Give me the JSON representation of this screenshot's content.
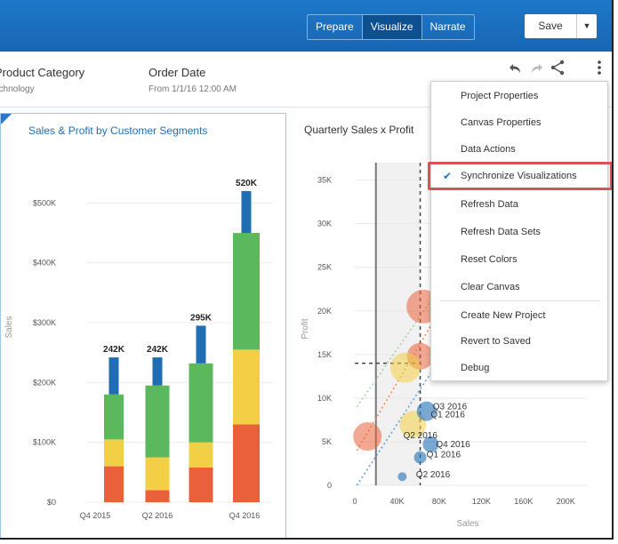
{
  "toolbar": {
    "tabs": [
      "Prepare",
      "Visualize",
      "Narrate"
    ],
    "active_tab": "Visualize",
    "save_label": "Save",
    "save_dropdown": "▼"
  },
  "filters": [
    {
      "title": "Product Category",
      "value": "Technology"
    },
    {
      "title": "Order Date",
      "value": "From 1/1/16 12:00 AM"
    }
  ],
  "icons": [
    "undo-icon",
    "redo-icon",
    "share-icon",
    "more-vertical-icon"
  ],
  "left_chart_title": "Sales & Profit by Customer Segments",
  "right_chart_title": "Quarterly Sales x Profit",
  "menu": {
    "items": [
      "Project Properties",
      "Canvas Properties",
      "Data Actions",
      "Synchronize Visualizations",
      "Refresh Data",
      "Refresh Data Sets",
      "Reset Colors",
      "Clear Canvas",
      "Create New Project",
      "Revert to Saved",
      "Debug"
    ],
    "checked_item": "Synchronize Visualizations",
    "check_icon": "✔"
  },
  "colors": {
    "accent": "#1f77c8",
    "seg_blue": "#1f6eb4",
    "seg_green": "#5cb85c",
    "seg_yellow": "#f2cf45",
    "seg_orange": "#e9603a",
    "highlight": "#d9534f"
  },
  "chart_data": [
    {
      "type": "bar",
      "title": "Sales & Profit by Customer Segments",
      "ylabel": "Sales",
      "yticks": [
        "$0",
        "$100K",
        "$200K",
        "$300K",
        "$400K",
        "$500K"
      ],
      "ylim": [
        0,
        560000
      ],
      "xticks": [
        "Q4 2015",
        "Q2 2016",
        "Q4 2016"
      ],
      "totals_labels": [
        "242K",
        "242K",
        "295K",
        "520K"
      ],
      "bars": [
        {
          "segments": [
            {
              "color": "orange",
              "from": 0,
              "to": 60000
            },
            {
              "color": "yellow",
              "from": 60000,
              "to": 105000
            },
            {
              "color": "green",
              "from": 105000,
              "to": 180000
            },
            {
              "color": "blue",
              "from": 180000,
              "to": 242000
            }
          ]
        },
        {
          "segments": [
            {
              "color": "orange",
              "from": 0,
              "to": 20000
            },
            {
              "color": "yellow",
              "from": 20000,
              "to": 75000
            },
            {
              "color": "green",
              "from": 75000,
              "to": 195000
            },
            {
              "color": "blue",
              "from": 195000,
              "to": 242000
            }
          ]
        },
        {
          "segments": [
            {
              "color": "orange",
              "from": 0,
              "to": 58000
            },
            {
              "color": "yellow",
              "from": 58000,
              "to": 100000
            },
            {
              "color": "green",
              "from": 100000,
              "to": 232000
            },
            {
              "color": "blue",
              "from": 232000,
              "to": 295000
            }
          ]
        },
        {
          "segments": [
            {
              "color": "orange",
              "from": 0,
              "to": 130000
            },
            {
              "color": "yellow",
              "from": 130000,
              "to": 255000
            },
            {
              "color": "green",
              "from": 255000,
              "to": 450000
            },
            {
              "color": "blue",
              "from": 450000,
              "to": 520000
            }
          ]
        }
      ]
    },
    {
      "type": "scatter",
      "title": "Quarterly Sales x Profit",
      "xlabel": "Sales",
      "ylabel": "Profit",
      "xticks": [
        "0",
        "40K",
        "80K",
        "120K",
        "160K",
        "200K"
      ],
      "yticks": [
        "0",
        "5K",
        "10K",
        "15K",
        "20K",
        "25K",
        "30K",
        "35K"
      ],
      "xlim": [
        0,
        220000
      ],
      "ylim": [
        0,
        37000
      ],
      "point_labels": [
        "Q3 2016",
        "Q1 2016",
        "Q2 2016",
        "Q4 2016",
        "Q1 2016",
        "Q2 2016"
      ],
      "points": [
        {
          "x": 65000,
          "y": 20500,
          "size": 19,
          "color": "orange"
        },
        {
          "x": 62000,
          "y": 14800,
          "size": 15,
          "color": "orange"
        },
        {
          "x": 48000,
          "y": 13500,
          "size": 17,
          "color": "yellow"
        },
        {
          "x": 12000,
          "y": 5600,
          "size": 16,
          "color": "orange"
        },
        {
          "x": 55000,
          "y": 7000,
          "size": 15,
          "color": "yellow"
        },
        {
          "x": 68000,
          "y": 8500,
          "size": 11,
          "color": "blue"
        },
        {
          "x": 72000,
          "y": 4700,
          "size": 9,
          "color": "blue"
        },
        {
          "x": 62000,
          "y": 3200,
          "size": 7,
          "color": "blue"
        },
        {
          "x": 45000,
          "y": 1000,
          "size": 5,
          "color": "blue"
        }
      ]
    }
  ]
}
